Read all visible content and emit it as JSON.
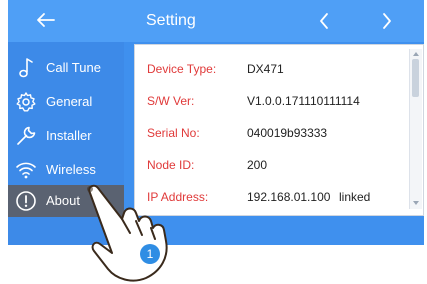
{
  "header": {
    "title": "Setting",
    "back_icon": "arrow-left-icon",
    "prev_icon": "chevron-left-icon",
    "next_icon": "chevron-right-icon"
  },
  "sidebar": {
    "items": [
      {
        "label": "Call Tune",
        "icon": "music-note-icon",
        "active": false
      },
      {
        "label": "General",
        "icon": "gear-icon",
        "active": false
      },
      {
        "label": "Installer",
        "icon": "wrench-icon",
        "active": false
      },
      {
        "label": "Wireless",
        "icon": "wifi-icon",
        "active": false
      },
      {
        "label": "About",
        "icon": "info-icon",
        "active": true
      }
    ]
  },
  "about": {
    "rows": [
      {
        "key": "Device Type:",
        "value": "DX471"
      },
      {
        "key": "S/W Ver:",
        "value": "V1.0.0.171110111114"
      },
      {
        "key": "Serial No:",
        "value": "040019b93333"
      },
      {
        "key": "Node ID:",
        "value": "200"
      },
      {
        "key": "IP Address:",
        "value": "192.168.01.100",
        "status": "linked"
      }
    ]
  },
  "step_badge": "1",
  "colors": {
    "accent": "#4f9ff6",
    "sidebar": "#3d8ae8",
    "active_item": "#5a6271",
    "label_red": "#e03a3a",
    "badge": "#2f8de4"
  }
}
